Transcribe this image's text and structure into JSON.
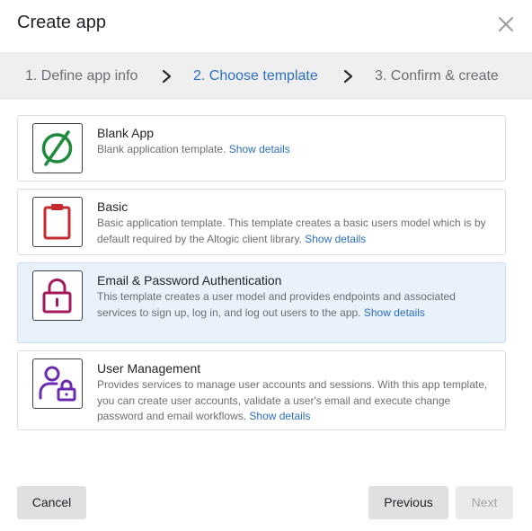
{
  "dialog": {
    "title": "Create app",
    "close_icon": "close-icon"
  },
  "steps": [
    {
      "label": "1. Define app info",
      "state": "done"
    },
    {
      "label": "2. Choose template",
      "state": "active"
    },
    {
      "label": "3. Confirm & create",
      "state": "pending"
    }
  ],
  "templates": [
    {
      "title": "Blank App",
      "desc_before": "Blank application template. ",
      "desc_continued": "",
      "link": "Show details",
      "link_second": "",
      "icon": "empty-set-icon",
      "icon_color": "#1f8a3c",
      "selected": false
    },
    {
      "title": "Basic",
      "desc_before": "Basic application template. This template creates a basic users model which is by default required by the Altogic client library. ",
      "desc_continued": "",
      "link": "Show details",
      "link_second": "",
      "icon": "clipboard-icon",
      "icon_color": "#c62a2f",
      "selected": false
    },
    {
      "title": "Email & Password Authentication",
      "desc_before": "This template creates a user model and provides endpoints and associated services to sign up, log in, and log out users to the app. ",
      "desc_continued": "",
      "link": "Show",
      "link_second": "details",
      "icon": "lock-icon",
      "icon_color": "#a3195b",
      "selected": true
    },
    {
      "title": "User Management",
      "desc_before": "Provides services to manage user accounts and sessions. With this app template, you can create user accounts, validate a user's email and execute change password and email workflows. ",
      "desc_continued": "",
      "link": "Show details",
      "link_second": "",
      "icon": "user-lock-icon",
      "icon_color": "#6a2bb0",
      "selected": false
    }
  ],
  "footer": {
    "cancel": "Cancel",
    "previous": "Previous",
    "next": "Next",
    "next_disabled": true
  },
  "colors": {
    "accent": "#2c6fc0",
    "step_bar": "#efefef",
    "selected_card": "#e9f1fb"
  }
}
